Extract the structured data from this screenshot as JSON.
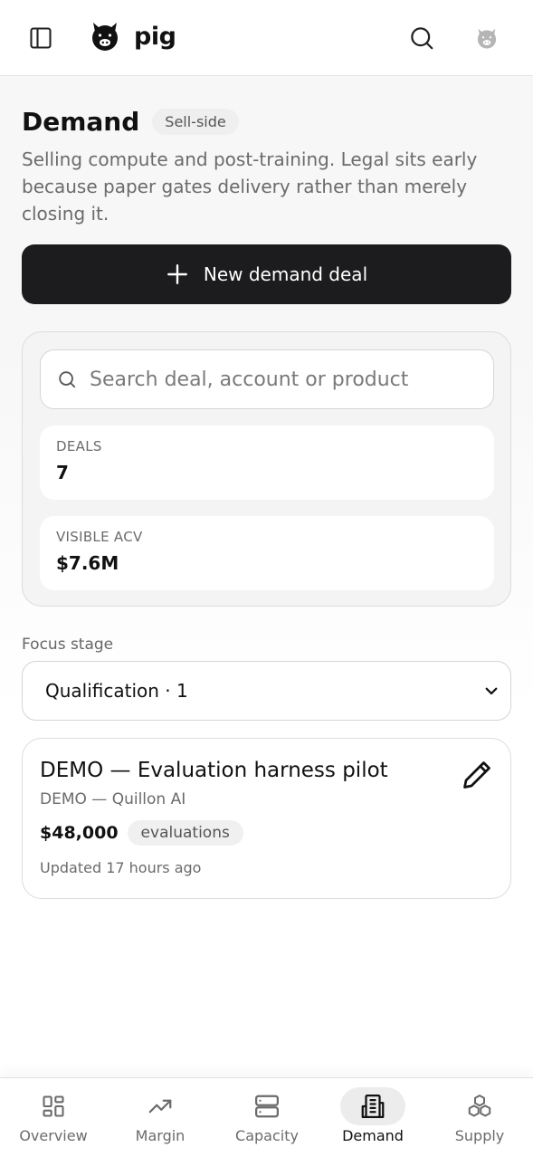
{
  "header": {
    "app_name": "pig",
    "icons": [
      "sidebar-toggle-icon",
      "pig-logo-icon",
      "search-icon",
      "pig-avatar-icon"
    ]
  },
  "page": {
    "title": "Demand",
    "badge": "Sell-side",
    "description": "Selling compute and post-training. Legal sits early because paper gates delivery rather than merely closing it.",
    "new_button_label": "New demand deal"
  },
  "filters": {
    "search_placeholder": "Search deal, account or product",
    "search_value": ""
  },
  "stats": [
    {
      "label": "DEALS",
      "value": "7"
    },
    {
      "label": "VISIBLE ACV",
      "value": "$7.6M"
    }
  ],
  "focus": {
    "label": "Focus stage",
    "selected": "Qualification · 1"
  },
  "deals": [
    {
      "title": "DEMO — Evaluation harness pilot",
      "account": "DEMO — Quillon AI",
      "value": "$48,000",
      "tag": "evaluations",
      "updated": "Updated 17 hours ago"
    }
  ],
  "nav": {
    "items": [
      {
        "label": "Overview",
        "icon": "overview-grid-icon",
        "active": false
      },
      {
        "label": "Margin",
        "icon": "trend-up-icon",
        "active": false
      },
      {
        "label": "Capacity",
        "icon": "server-icon",
        "active": false
      },
      {
        "label": "Demand",
        "icon": "building-icon",
        "active": true
      },
      {
        "label": "Supply",
        "icon": "boxes-icon",
        "active": false
      }
    ]
  },
  "colors": {
    "primary_button": "#1c1c1e",
    "background_tint": "#f7f7f7",
    "active_nav_bg": "#ececec"
  }
}
